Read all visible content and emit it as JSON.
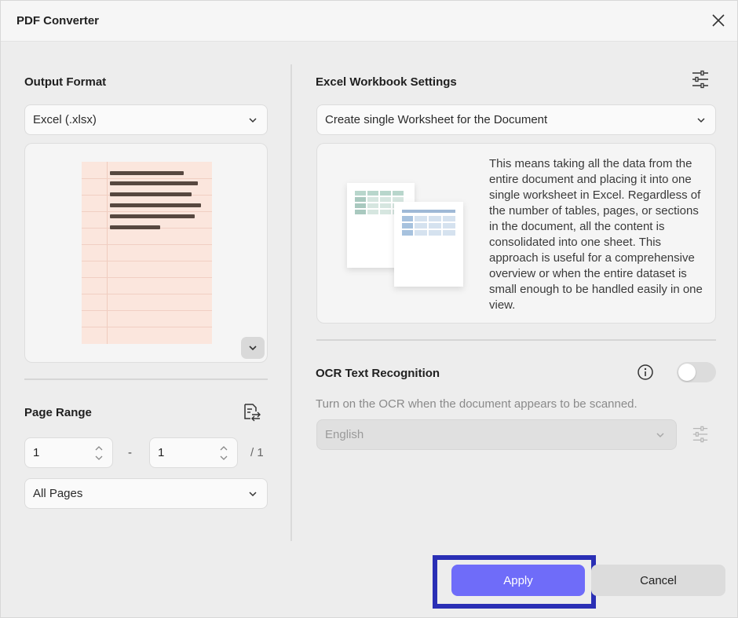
{
  "window": {
    "title": "PDF Converter"
  },
  "output_format": {
    "heading": "Output Format",
    "selected": "Excel (.xlsx)"
  },
  "page_range": {
    "heading": "Page Range",
    "from": "1",
    "separator": "-",
    "to": "1",
    "total": "/ 1",
    "pages_option": "All Pages"
  },
  "excel_settings": {
    "heading": "Excel Workbook Settings",
    "selected": "Create single Worksheet for the Document",
    "description": "This means taking all the data from the entire document and placing it into one single worksheet in Excel. Regardless of the number of tables, pages, or sections in the document, all the content is consolidated into one sheet. This approach is useful for a comprehensive overview or when the entire dataset is small enough to be handled easily in one view."
  },
  "ocr": {
    "heading": "OCR Text Recognition",
    "enabled": false,
    "hint": "Turn on the OCR when the document appears to be scanned.",
    "language": "English"
  },
  "buttons": {
    "apply": "Apply",
    "cancel": "Cancel"
  },
  "colors": {
    "accent": "#6f6cf9",
    "highlight_frame": "#2a2fb5",
    "preview_sheet": "#fbe6dd"
  },
  "icons": {
    "close": "close-icon",
    "settings": "sliders-icon",
    "page_range": "page-swap-icon",
    "info": "info-icon",
    "chevron": "chevron-down-icon"
  }
}
